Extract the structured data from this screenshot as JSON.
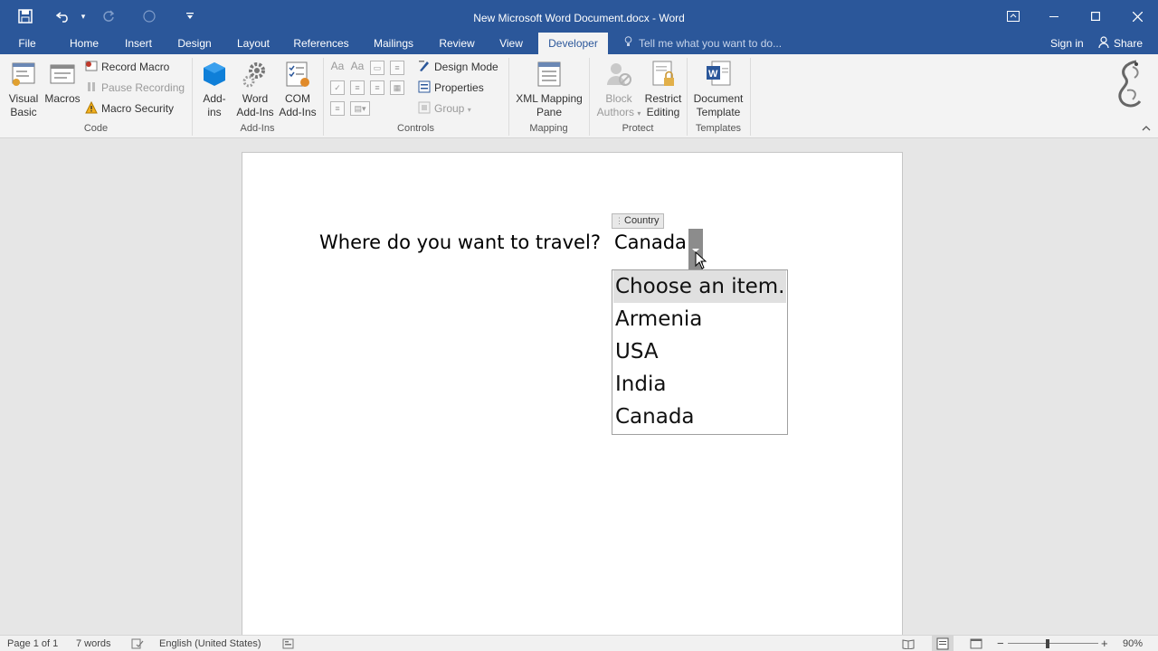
{
  "window": {
    "title": "New Microsoft Word Document.docx - Word"
  },
  "qat": {
    "save_icon": "save-icon",
    "undo_icon": "undo-icon",
    "redo_icon": "redo-icon",
    "touch_icon": "touch-mode-icon",
    "customize_icon": "customize-qat-icon"
  },
  "tabs": {
    "file": "File",
    "home": "Home",
    "insert": "Insert",
    "design": "Design",
    "layout": "Layout",
    "references": "References",
    "mailings": "Mailings",
    "review": "Review",
    "view": "View",
    "developer": "Developer",
    "tellme_placeholder": "Tell me what you want to do...",
    "signin": "Sign in",
    "share": "Share"
  },
  "ribbon": {
    "code": {
      "label": "Code",
      "visual_basic_line1": "Visual",
      "visual_basic_line2": "Basic",
      "macros": "Macros",
      "record_macro": "Record Macro",
      "pause_recording": "Pause Recording",
      "macro_security": "Macro Security"
    },
    "addins": {
      "label": "Add-Ins",
      "addins_line1": "Add-",
      "addins_line2": "ins",
      "word_addins_line1": "Word",
      "word_addins_line2": "Add-Ins",
      "com_addins_line1": "COM",
      "com_addins_line2": "Add-Ins"
    },
    "controls": {
      "label": "Controls",
      "design_mode": "Design Mode",
      "properties": "Properties",
      "group": "Group"
    },
    "mapping": {
      "label": "Mapping",
      "xml_line1": "XML Mapping",
      "xml_line2": "Pane"
    },
    "protect": {
      "label": "Protect",
      "block_line1": "Block",
      "block_line2": "Authors",
      "restrict_line1": "Restrict",
      "restrict_line2": "Editing"
    },
    "templates": {
      "label": "Templates",
      "doc_line1": "Document",
      "doc_line2": "Template"
    }
  },
  "document": {
    "question": "Where do you want to travel?",
    "content_control_title": "Country",
    "content_control_value": "Canada",
    "dropdown_items": [
      "Choose an item.",
      "Armenia",
      "USA",
      "India",
      "Canada"
    ],
    "highlighted_index": 0
  },
  "status": {
    "page": "Page 1 of 1",
    "words": "7 words",
    "language": "English (United States)",
    "zoom": "90%"
  },
  "colors": {
    "accent": "#2b579a",
    "ribbon_bg": "#f3f3f3"
  }
}
